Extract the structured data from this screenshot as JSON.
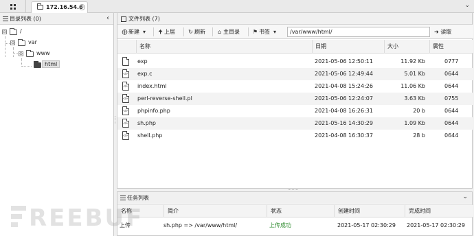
{
  "topbar": {
    "tab_label": "172.16.54.6",
    "tab_close": "⊗"
  },
  "left_panel": {
    "title": "目录列表 (0)",
    "tree": [
      {
        "label": "/",
        "toggle": "⊖"
      },
      {
        "label": "var",
        "toggle": "⊖"
      },
      {
        "label": "www",
        "toggle": "⊖"
      },
      {
        "label": "html",
        "selected": true
      }
    ]
  },
  "right_panel": {
    "title": "文件列表 (7)",
    "toolbar": {
      "new_label": "新建",
      "up_label": "上层",
      "refresh_label": "刷新",
      "home_label": "主目录",
      "bookmark_label": "书签",
      "path_value": "/var/www/html/",
      "read_label": "读取"
    },
    "columns": {
      "name": "名称",
      "date": "日期",
      "size": "大小",
      "attr": "属性"
    },
    "files": [
      {
        "name": "exp",
        "date": "2021-05-06 12:50:11",
        "size": "11.92 Kb",
        "attr": "0777",
        "icon": "file-icon"
      },
      {
        "name": "exp.c",
        "date": "2021-05-06 12:49:44",
        "size": "5.01 Kb",
        "attr": "0644",
        "icon": "code-file-icon"
      },
      {
        "name": "index.html",
        "date": "2021-04-08 15:24:26",
        "size": "11.06 Kb",
        "attr": "0644",
        "icon": "code-file-icon"
      },
      {
        "name": "perl-reverse-shell.pl",
        "date": "2021-05-06 12:24:07",
        "size": "3.63 Kb",
        "attr": "0755",
        "icon": "code-file-icon"
      },
      {
        "name": "phpinfo.php",
        "date": "2021-04-08 16:26:31",
        "size": "20 b",
        "attr": "0644",
        "icon": "code-file-icon"
      },
      {
        "name": "sh.php",
        "date": "2021-05-16 14:30:29",
        "size": "1.09 Kb",
        "attr": "0644",
        "icon": "code-file-icon"
      },
      {
        "name": "shell.php",
        "date": "2021-04-08 16:30:37",
        "size": "28 b",
        "attr": "0644",
        "icon": "code-file-icon"
      }
    ]
  },
  "tasks_panel": {
    "title": "任务列表",
    "columns": {
      "name": "名称",
      "desc": "简介",
      "status": "状态",
      "created": "创建时间",
      "done": "完成时间"
    },
    "rows": [
      {
        "name": "上传",
        "desc": "sh.php => /var/www/html/",
        "status": "上传成功",
        "created": "2021-05-17 02:30:29",
        "done": "2021-05-17 02:30:29"
      }
    ]
  },
  "watermark": {
    "text": "REEBUF"
  },
  "colors": {
    "success": "#2e8b2e",
    "header_bg": "#f0f0f0",
    "row_alt": "#f3f3f3"
  }
}
